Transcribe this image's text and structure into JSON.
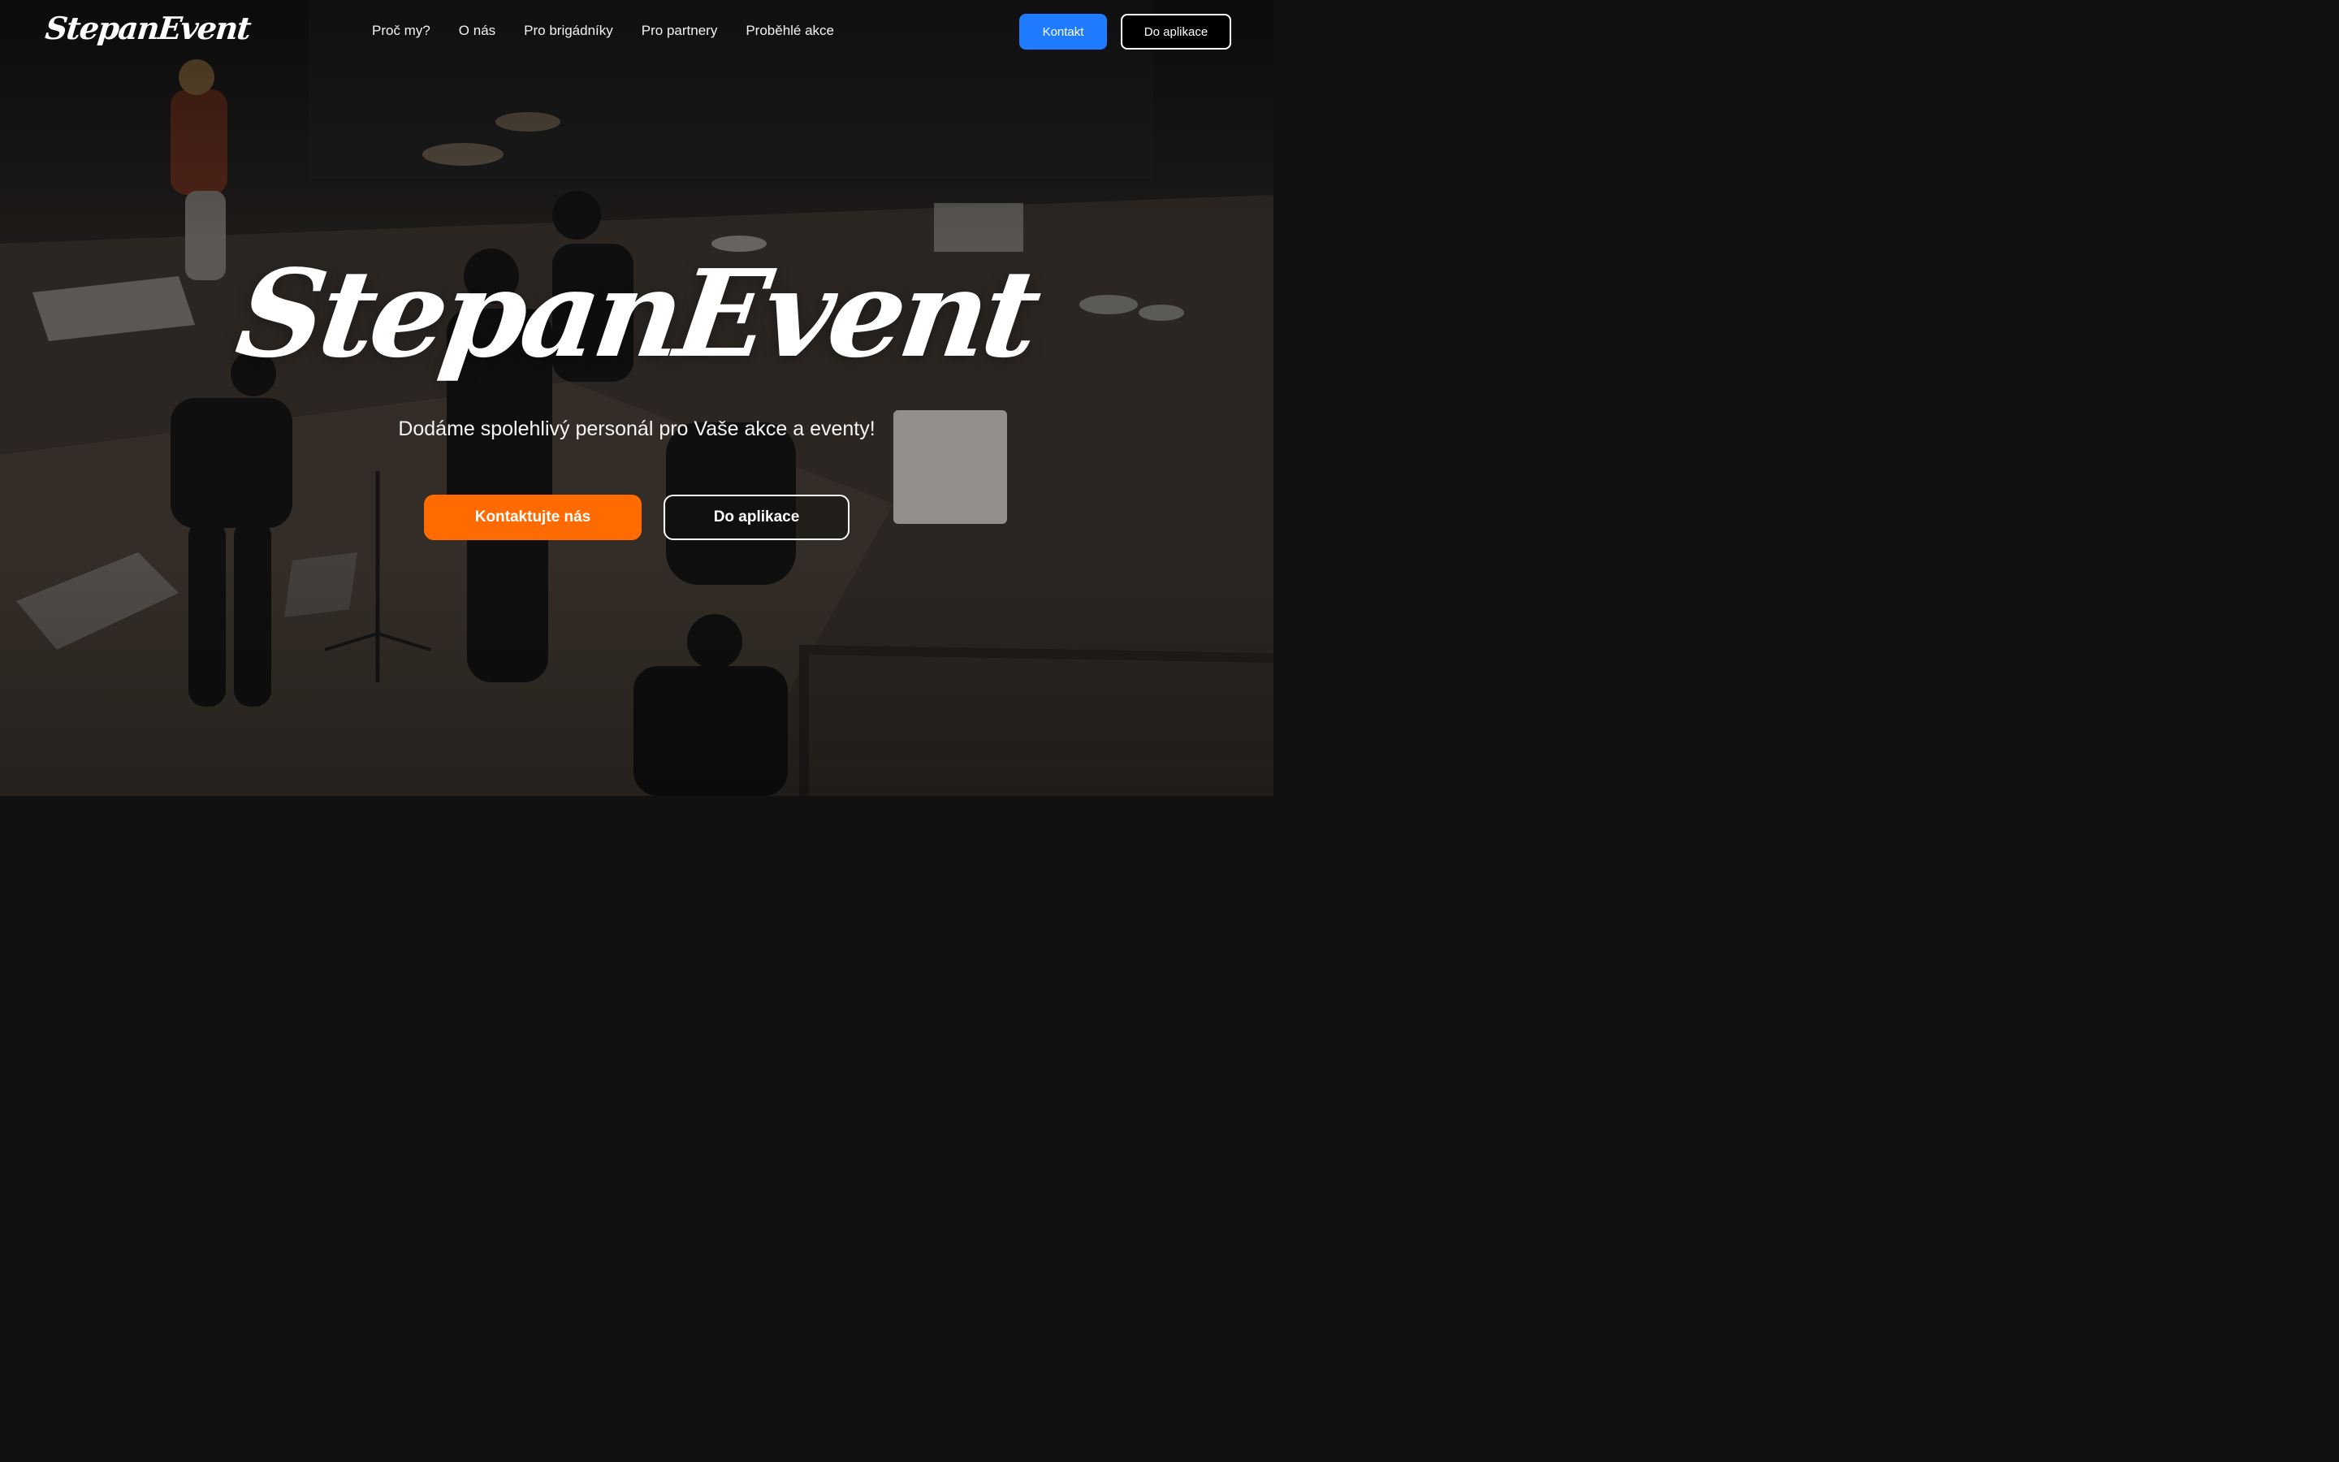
{
  "brand": {
    "logo_text": "StepanEvent"
  },
  "nav": {
    "links": [
      {
        "label": "Proč my?"
      },
      {
        "label": "O nás"
      },
      {
        "label": "Pro brigádníky"
      },
      {
        "label": "Pro partnery"
      },
      {
        "label": "Proběhlé akce"
      }
    ],
    "contact_label": "Kontakt",
    "app_label": "Do aplikace"
  },
  "hero": {
    "title": "StepanEvent",
    "subtitle": "Dodáme spolehlivý personál pro Vaše akce a eventy!",
    "cta_primary_label": "Kontaktujte nás",
    "cta_secondary_label": "Do aplikace",
    "background_description_icon": "stage-photo"
  },
  "colors": {
    "accent_blue": "#1f7bff",
    "accent_orange": "#ff6b00",
    "text": "#ffffff",
    "nav_bg": "#000000"
  }
}
